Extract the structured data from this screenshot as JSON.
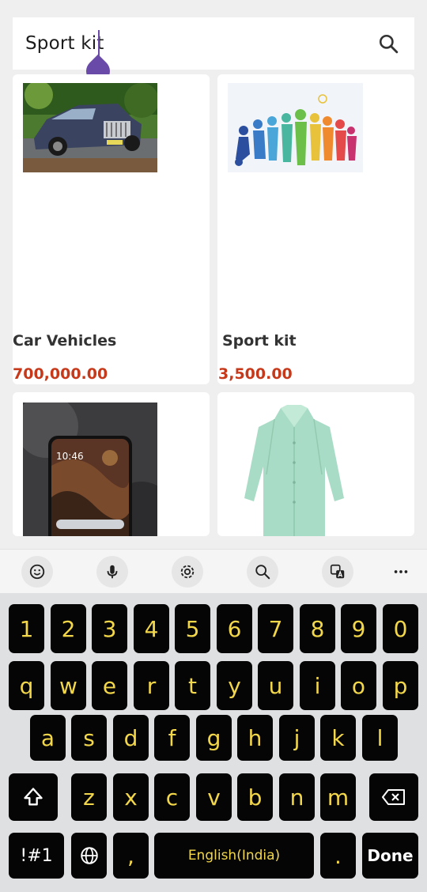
{
  "search": {
    "query": "Sport kit"
  },
  "products": [
    {
      "name": "Car Vehicles",
      "price": "700,000.00"
    },
    {
      "name": "Sport kit",
      "price": "3,500.00"
    },
    {
      "name": "",
      "price": ""
    },
    {
      "name": "",
      "price": ""
    }
  ],
  "phone_image": {
    "clock": "10:46"
  },
  "toolbar": {
    "tools": [
      "emoji-icon",
      "mic-icon",
      "settings-icon",
      "search-icon",
      "translate-icon",
      "more-icon"
    ]
  },
  "keyboard": {
    "row_numbers": [
      "1",
      "2",
      "3",
      "4",
      "5",
      "6",
      "7",
      "8",
      "9",
      "0"
    ],
    "row_top": [
      "q",
      "w",
      "e",
      "r",
      "t",
      "y",
      "u",
      "i",
      "o",
      "p"
    ],
    "row_middle": [
      "a",
      "s",
      "d",
      "f",
      "g",
      "h",
      "j",
      "k",
      "l"
    ],
    "row_bottom": [
      "z",
      "x",
      "c",
      "v",
      "b",
      "n",
      "m"
    ],
    "symbols_label": "!#1",
    "comma_label": ",",
    "space_label": "English(India)",
    "period_label": ".",
    "done_label": "Done"
  },
  "colors": {
    "accent": "#6a4aa8",
    "price": "#c6391b",
    "key_background": "#050505",
    "key_text": "#f3d74a"
  }
}
